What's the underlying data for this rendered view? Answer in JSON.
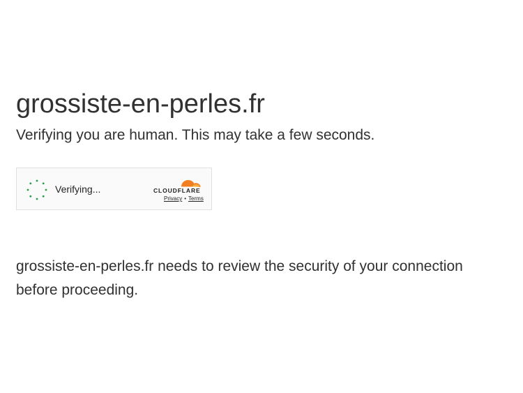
{
  "page": {
    "site_title": "grossiste-en-perles.fr",
    "subtitle": "Verifying you are human. This may take a few seconds."
  },
  "widget": {
    "status_text": "Verifying...",
    "brand": "CLOUDFLARE",
    "privacy_label": "Privacy",
    "separator": "•",
    "terms_label": "Terms",
    "spinner_icon": "spinner-icon",
    "logo_icon": "cloudflare-cloud-icon",
    "colors": {
      "spinner": "#2a9d4a",
      "cloud_orange": "#f38020",
      "cloud_light": "#faae40"
    }
  },
  "message": {
    "text": "grossiste-en-perles.fr needs to review the security of your connection before proceeding."
  }
}
